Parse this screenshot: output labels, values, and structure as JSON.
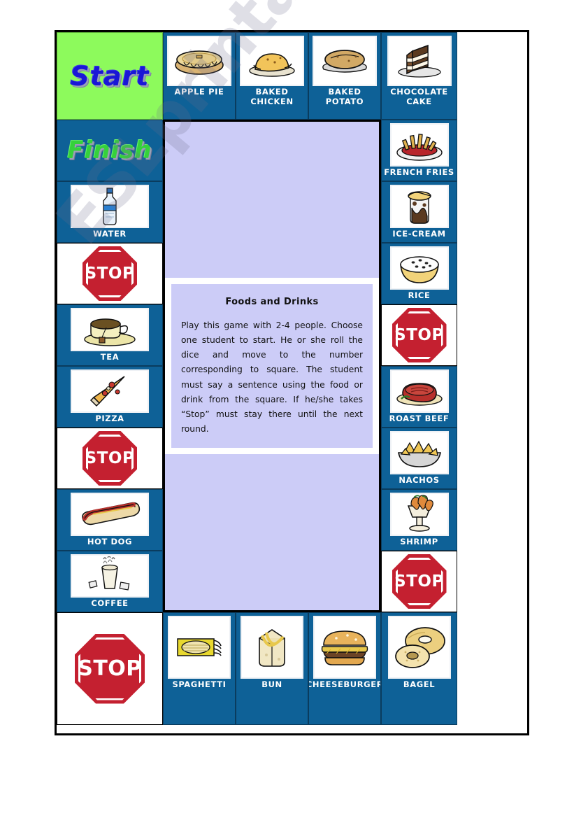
{
  "worksheet": {
    "watermark": "ESLprintables.com"
  },
  "board": {
    "start_label": "Start",
    "finish_label": "Finish",
    "stop_label": "STOP"
  },
  "instructions": {
    "title": "Foods and Drinks",
    "body": "Play this game with 2-4 people. Choose one student to start. He or she roll the dice and move to the number corresponding to square. The student must say a sentence using the food or drink from the square. If he/she takes “Stop” must stay there until the next round."
  },
  "top_row": [
    {
      "label": "APPLE PIE",
      "icon": "pie-icon"
    },
    {
      "label": "BAKED CHICKEN",
      "icon": "chicken-icon"
    },
    {
      "label": "BAKED POTATO",
      "icon": "potato-icon"
    },
    {
      "label": "CHOCOLATE CAKE",
      "icon": "cake-slice-icon"
    }
  ],
  "right_column": [
    {
      "type": "food",
      "label": "FRENCH FRIES",
      "icon": "fries-icon"
    },
    {
      "type": "food",
      "label": "ICE-CREAM",
      "icon": "ice-cream-icon"
    },
    {
      "type": "food",
      "label": "RICE",
      "icon": "rice-bowl-icon"
    },
    {
      "type": "stop",
      "label": "STOP",
      "icon": "stop-sign-icon"
    },
    {
      "type": "food",
      "label": "ROAST BEEF",
      "icon": "roast-beef-icon"
    },
    {
      "type": "food",
      "label": "NACHOS",
      "icon": "nachos-icon"
    },
    {
      "type": "food",
      "label": "SHRIMP",
      "icon": "shrimp-cocktail-icon"
    },
    {
      "type": "stop",
      "label": "STOP",
      "icon": "stop-sign-icon"
    }
  ],
  "bottom_row": [
    {
      "type": "stop",
      "label": "STOP",
      "icon": "stop-sign-icon"
    },
    {
      "type": "food",
      "label": "SPAGHETTI",
      "icon": "spaghetti-icon"
    },
    {
      "type": "food",
      "label": "BUN",
      "icon": "bun-icon"
    },
    {
      "type": "food",
      "label": "CHEESEBURGER",
      "icon": "cheeseburger-icon"
    },
    {
      "type": "food",
      "label": "BAGEL",
      "icon": "bagel-icon"
    }
  ],
  "left_column": [
    {
      "type": "start",
      "label": "Start"
    },
    {
      "type": "finish",
      "label": "Finish"
    },
    {
      "type": "food",
      "label": "WATER",
      "icon": "water-bottle-icon"
    },
    {
      "type": "stop",
      "label": "STOP",
      "icon": "stop-sign-icon"
    },
    {
      "type": "food",
      "label": "TEA",
      "icon": "teacup-icon"
    },
    {
      "type": "food",
      "label": "PIZZA",
      "icon": "pizza-slice-icon"
    },
    {
      "type": "stop",
      "label": "STOP",
      "icon": "stop-sign-icon"
    },
    {
      "type": "food",
      "label": "HOT DOG",
      "icon": "hot-dog-icon"
    },
    {
      "type": "food",
      "label": "COFFEE",
      "icon": "coffee-cup-icon"
    }
  ],
  "colors": {
    "card_blue": "#0e6197",
    "start_green": "#8dfa5c",
    "panel_lavender": "#ccccf7",
    "stop_red": "#c42030",
    "start_text_blue": "#1a17d6",
    "finish_text_green": "#35d13b"
  }
}
